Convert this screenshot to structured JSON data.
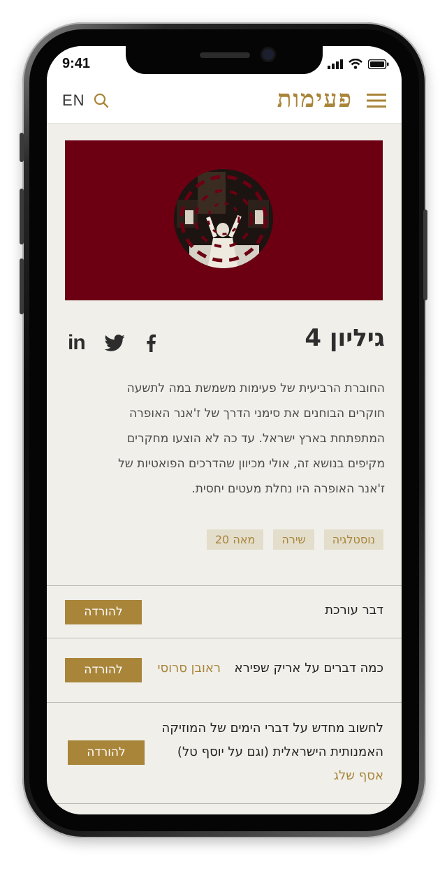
{
  "status_bar": {
    "time": "9:41"
  },
  "header": {
    "lang_label": "EN",
    "logo_text": "פעימות"
  },
  "issue": {
    "title": "גיליון 4",
    "description": "החוברת הרביעית של פעימות משמשת במה לתשעה חוקרים הבוחנים את סימני הדרך של ז'אנר האופרה המתפתחת בארץ ישראל. עד כה לא הוצעו מחקרים מקיפים בנושא זה, אולי מכיוון שהדרכים הפואטיות של ז'אנר האופרה היו נחלת מעטים יחסית.",
    "tags": [
      "נוסטלגיה",
      "שירה",
      "מאה 20"
    ]
  },
  "social": {
    "linkedin_label": "in"
  },
  "articles": [
    {
      "title": "דבר עורכת",
      "author": "",
      "button": "להורדה"
    },
    {
      "title": "כמה דברים על אריק שפירא",
      "author": "ראובן סרוסי",
      "button": "להורדה"
    },
    {
      "title": "לחשוב מחדש על דברי הימים של המוזיקה האמנותית הישראלית (וגם על יוסף טל)",
      "author": "אסף שלג",
      "button": "להורדה"
    }
  ],
  "colors": {
    "accent": "#a9853a",
    "hero_bg": "#6c0012",
    "page_bg": "#f0efea"
  }
}
